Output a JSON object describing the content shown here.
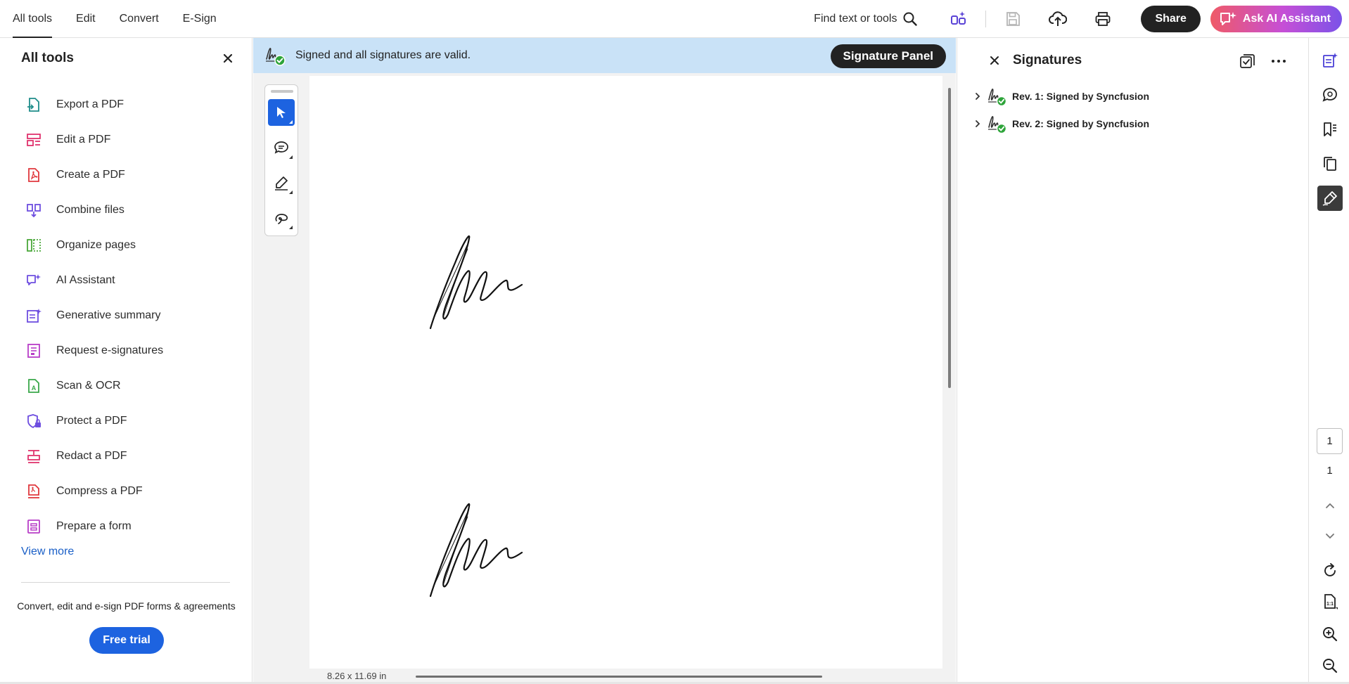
{
  "topnav": {
    "tabs": [
      {
        "label": "All tools",
        "active": true
      },
      {
        "label": "Edit",
        "active": false
      },
      {
        "label": "Convert",
        "active": false
      },
      {
        "label": "E-Sign",
        "active": false
      }
    ]
  },
  "toolbar": {
    "find_label": "Find text or tools",
    "share_label": "Share",
    "ai_label": "Ask AI Assistant"
  },
  "left_panel": {
    "title": "All tools",
    "tools": [
      {
        "label": "Export a PDF",
        "icon": "export-pdf-icon",
        "color": "#1f8d8a"
      },
      {
        "label": "Edit a PDF",
        "icon": "edit-pdf-icon",
        "color": "#e0336e"
      },
      {
        "label": "Create a PDF",
        "icon": "create-pdf-icon",
        "color": "#e0393e"
      },
      {
        "label": "Combine files",
        "icon": "combine-files-icon",
        "color": "#6e4ee0"
      },
      {
        "label": "Organize pages",
        "icon": "organize-pages-icon",
        "color": "#4aa83a"
      },
      {
        "label": "AI Assistant",
        "icon": "ai-assistant-icon",
        "color": "#6e4ee0"
      },
      {
        "label": "Generative summary",
        "icon": "generative-summary-icon",
        "color": "#6e4ee0"
      },
      {
        "label": "Request e-signatures",
        "icon": "request-esignatures-icon",
        "color": "#b83ec8"
      },
      {
        "label": "Scan & OCR",
        "icon": "scan-ocr-icon",
        "color": "#3aa84a"
      },
      {
        "label": "Protect a PDF",
        "icon": "protect-pdf-icon",
        "color": "#6e4ee0"
      },
      {
        "label": "Redact a PDF",
        "icon": "redact-pdf-icon",
        "color": "#e0336e"
      },
      {
        "label": "Compress a PDF",
        "icon": "compress-pdf-icon",
        "color": "#e0393e"
      },
      {
        "label": "Prepare a form",
        "icon": "prepare-form-icon",
        "color": "#b83ec8"
      }
    ],
    "view_more": "View more",
    "promo": "Convert, edit and e-sign PDF forms & agreements",
    "trial_label": "Free trial"
  },
  "document": {
    "banner_text": "Signed and all signatures are valid.",
    "signature_panel_label": "Signature Panel",
    "page_size": "8.26 x 11.69 in"
  },
  "signatures_panel": {
    "title": "Signatures",
    "revisions": [
      {
        "label": "Rev. 1: Signed by Syncfusion"
      },
      {
        "label": "Rev. 2: Signed by Syncfusion"
      }
    ]
  },
  "page_nav": {
    "current": "1",
    "total": "1"
  },
  "colors": {
    "accent_blue": "#1d63e0",
    "banner_blue": "#c9e2f7",
    "valid_green": "#2ea43a"
  }
}
